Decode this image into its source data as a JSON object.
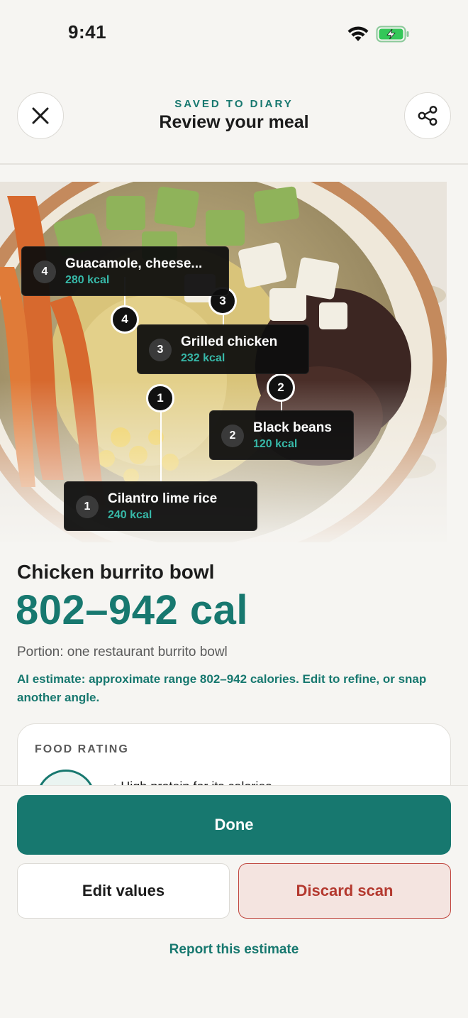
{
  "status_bar": {
    "time": "9:41"
  },
  "header": {
    "kicker": "SAVED TO DIARY",
    "title": "Review your meal",
    "close_icon": "close-icon",
    "share_icon": "share-icon"
  },
  "photo": {
    "subject": "burrito bowl photo",
    "items": [
      {
        "number": "1",
        "name": "Cilantro lime rice",
        "kcal": "240 kcal"
      },
      {
        "number": "2",
        "name": "Black beans",
        "kcal": "120 kcal"
      },
      {
        "number": "3",
        "name": "Grilled chicken",
        "kcal": "232 kcal"
      },
      {
        "number": "4",
        "name": "Guacamole, cheese...",
        "kcal": "280 kcal"
      }
    ]
  },
  "meal": {
    "name": "Chicken burrito bowl",
    "calories": "802–942 cal",
    "portion": "Portion: one restaurant burrito bowl",
    "ai_note": "AI estimate: approximate range 802–942 calories. Edit to refine, or snap another angle."
  },
  "rating": {
    "label": "FOOD RATING",
    "bullet": "•  High protein for its calories"
  },
  "actions": {
    "done": "Done",
    "edit": "Edit values",
    "discard": "Discard scan",
    "report": "Report this estimate"
  },
  "colors": {
    "accent": "#17786f",
    "danger": "#b4392f",
    "background": "#f6f5f2"
  }
}
